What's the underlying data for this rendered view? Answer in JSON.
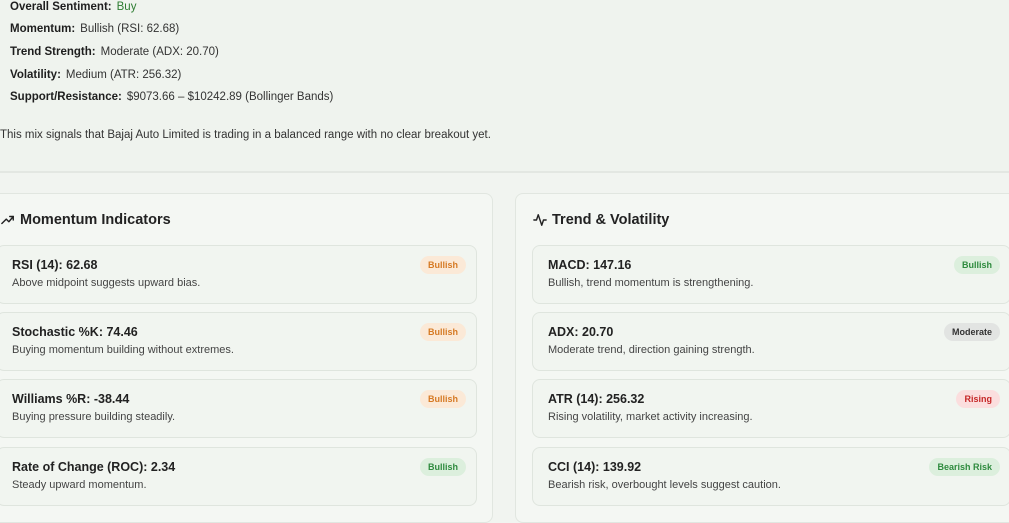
{
  "summary": {
    "overall_label": "Overall Sentiment:",
    "overall_value": "Buy",
    "momentum_label": "Momentum:",
    "momentum_value": "Bullish (RSI: 62.68)",
    "trend_label": "Trend Strength:",
    "trend_value": "Moderate (ADX: 20.70)",
    "volatility_label": "Volatility:",
    "volatility_value": "Medium (ATR: 256.32)",
    "sr_label": "Support/Resistance:",
    "sr_value": "$9073.66 – $10242.89 (Bollinger Bands)",
    "note": "This mix signals that Bajaj Auto Limited is trading in a balanced range with no clear breakout yet."
  },
  "momentum": {
    "title": "Momentum Indicators",
    "icon": "trending-up-icon",
    "cards": [
      {
        "title": "RSI (14): 62.68",
        "desc": "Above midpoint suggests upward bias.",
        "badge": "Bullish",
        "badge_color": "#d67a24"
      },
      {
        "title": "Stochastic %K: 74.46",
        "desc": "Buying momentum building without extremes.",
        "badge": "Bullish",
        "badge_color": "#d67a24"
      },
      {
        "title": "Williams %R: -38.44",
        "desc": "Buying pressure building steadily.",
        "badge": "Bullish",
        "badge_color": "#d67a24"
      },
      {
        "title": "Rate of Change (ROC): 2.34",
        "desc": "Steady upward momentum.",
        "badge": "Bullish",
        "badge_color": "#2e8b3e"
      }
    ]
  },
  "trend": {
    "title": "Trend & Volatility",
    "icon": "activity-pulse-icon",
    "cards": [
      {
        "title": "MACD: 147.16",
        "desc": "Bullish, trend momentum is strengthening.",
        "badge": "Bullish",
        "badge_color": "#2e8b3e"
      },
      {
        "title": "ADX: 20.70",
        "desc": "Moderate trend, direction gaining strength.",
        "badge": "Moderate",
        "badge_color": "#333333"
      },
      {
        "title": "ATR (14): 256.32",
        "desc": "Rising volatility, market activity increasing.",
        "badge": "Rising",
        "badge_color": "#c62828"
      },
      {
        "title": "CCI (14): 139.92",
        "desc": "Bearish risk, overbought levels suggest caution.",
        "badge": "Bearish Risk",
        "badge_color": "#2e8b3e"
      }
    ]
  }
}
